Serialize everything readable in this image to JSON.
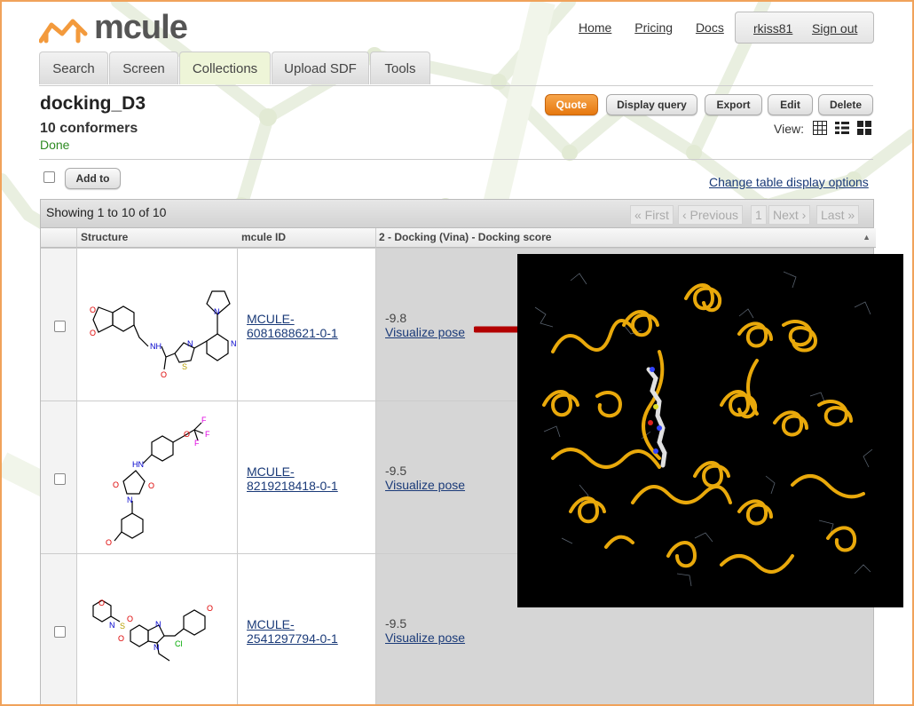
{
  "brand": {
    "name": "mcule",
    "accent": "#f39a3c"
  },
  "topnav": {
    "home": "Home",
    "pricing": "Pricing",
    "docs": "Docs"
  },
  "user": {
    "username": "rkiss81",
    "signout": "Sign out"
  },
  "tabs": [
    {
      "label": "Search"
    },
    {
      "label": "Screen"
    },
    {
      "label": "Collections",
      "active": true
    },
    {
      "label": "Upload SDF"
    },
    {
      "label": "Tools"
    }
  ],
  "collection": {
    "title": "docking_D3",
    "count": "10 conformers",
    "status": "Done"
  },
  "actions": {
    "quote": "Quote",
    "display_query": "Display query",
    "export": "Export",
    "edit": "Edit",
    "delete": "Delete"
  },
  "view": {
    "label": "View:",
    "icons": [
      "grid-view-icon",
      "list-view-icon",
      "tile-view-icon"
    ]
  },
  "toolbar": {
    "add_to": "Add to",
    "change_table": "Change table display options"
  },
  "table": {
    "showing": "Showing 1 to 10 of 10",
    "pager": {
      "first": "« First",
      "previous": "‹ Previous",
      "page": "1",
      "next": "Next ›",
      "last": "Last »"
    },
    "columns": [
      "Structure",
      "mcule ID",
      "2 - Docking (Vina) - Docking score"
    ],
    "rows": [
      {
        "id_line1": "MCULE-",
        "id_line2": "6081688621-0-1",
        "score": "-9.8",
        "visualize": "Visualize pose"
      },
      {
        "id_line1": "MCULE-",
        "id_line2": "8219218418-0-1",
        "score": "-9.5",
        "visualize": "Visualize pose"
      },
      {
        "id_line1": "MCULE-",
        "id_line2": "2541297794-0-1",
        "score": "-9.5",
        "visualize": "Visualize pose"
      }
    ]
  }
}
